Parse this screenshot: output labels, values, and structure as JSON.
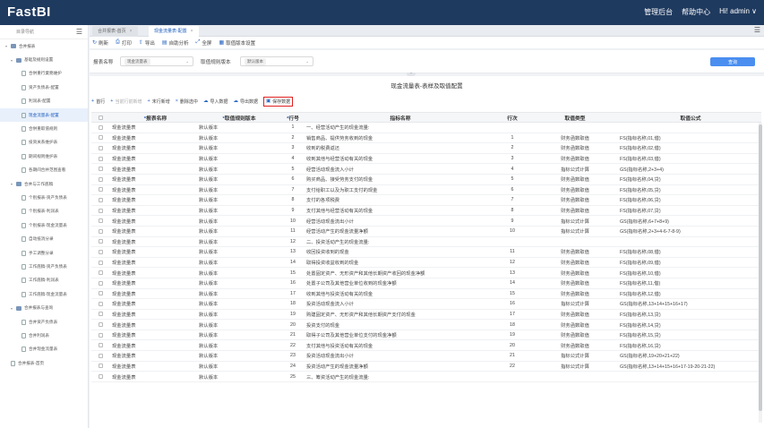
{
  "app": {
    "title": "FastBI",
    "nav": [
      "管理后台",
      "帮助中心",
      "Hi! admin ∨"
    ]
  },
  "sidebar": {
    "header": "目录导航",
    "items": [
      {
        "label": "合并报表",
        "level": 0,
        "kind": "folder",
        "expanded": true
      },
      {
        "label": "基础及规则设置",
        "level": 1,
        "kind": "folder",
        "expanded": true
      },
      {
        "label": "合併重行業務維护",
        "level": 2,
        "kind": "doc"
      },
      {
        "label": "资产负债表-配置",
        "level": 2,
        "kind": "doc"
      },
      {
        "label": "利润表-配置",
        "level": 2,
        "kind": "doc"
      },
      {
        "label": "现金流量表-配置",
        "level": 2,
        "kind": "doc",
        "active": true
      },
      {
        "label": "合併重取值规则",
        "level": 2,
        "kind": "doc"
      },
      {
        "label": "投资关系维护表",
        "level": 2,
        "kind": "doc"
      },
      {
        "label": "期间规则维护表",
        "level": 2,
        "kind": "doc"
      },
      {
        "label": "各期间合并范围查看",
        "level": 2,
        "kind": "doc"
      },
      {
        "label": "合并与工作底稿",
        "level": 1,
        "kind": "folder",
        "expanded": true
      },
      {
        "label": "个别报表-资产负债表",
        "level": 2,
        "kind": "doc"
      },
      {
        "label": "个别报表-利润表",
        "level": 2,
        "kind": "doc"
      },
      {
        "label": "个别报表-现金流量表",
        "level": 2,
        "kind": "doc"
      },
      {
        "label": "自动抵消分录",
        "level": 2,
        "kind": "doc"
      },
      {
        "label": "手工调整分录",
        "level": 2,
        "kind": "doc"
      },
      {
        "label": "工作底稿-资产负债表",
        "level": 2,
        "kind": "doc"
      },
      {
        "label": "工作底稿-利润表",
        "level": 2,
        "kind": "doc"
      },
      {
        "label": "工作底稿-现金流量表",
        "level": 2,
        "kind": "doc"
      },
      {
        "label": "合并报表与查询",
        "level": 1,
        "kind": "folder",
        "expanded": true
      },
      {
        "label": "合并资产负债表",
        "level": 2,
        "kind": "doc"
      },
      {
        "label": "合并利润表",
        "level": 2,
        "kind": "doc"
      },
      {
        "label": "合并现金流量表",
        "level": 2,
        "kind": "doc"
      },
      {
        "label": "合并报表-首页",
        "level": 1,
        "kind": "doc"
      }
    ]
  },
  "tabs": [
    {
      "label": "合并报表-首页",
      "active": false
    },
    {
      "label": "现金流量表-配置",
      "active": true
    }
  ],
  "toolbar": {
    "items": [
      {
        "icon": "↻",
        "label": "刷新"
      },
      {
        "icon": "⎙",
        "label": "打印"
      },
      {
        "icon": "⇧",
        "label": "导出"
      },
      {
        "icon": "▤",
        "label": "自助分析"
      },
      {
        "icon": "⤢",
        "label": "全屏"
      },
      {
        "icon": "▦",
        "label": "取值版本设置"
      }
    ]
  },
  "filters": {
    "report_label": "报表名称",
    "report_value": "现金流量表",
    "version_label": "取值规则版本",
    "version_value": "默认版本",
    "query_button": "查询"
  },
  "main": {
    "title": "现金流量表-表样及取值配置",
    "actions": [
      {
        "icon": "+",
        "label": "首行",
        "disabled": false
      },
      {
        "icon": "+",
        "label": "当前行前新增",
        "disabled": true
      },
      {
        "icon": "+",
        "label": "末行新增",
        "disabled": false
      },
      {
        "icon": "×",
        "label": "删除选中",
        "disabled": false
      },
      {
        "icon": "☁",
        "label": "导入数据",
        "disabled": false
      },
      {
        "icon": "☁",
        "label": "导出数据",
        "disabled": false
      },
      {
        "icon": "▣",
        "label": "保存数据",
        "disabled": false,
        "highlight": true
      }
    ]
  },
  "table": {
    "columns": {
      "name": "报表名称",
      "version": "取值规则版本",
      "seq": "行号",
      "indicator": "指标名称",
      "row": "行次",
      "type": "取值类型",
      "formula": "取值公式"
    },
    "rows": [
      {
        "name": "现金流量表",
        "version": "默认版本",
        "seq": "1",
        "indicator": "一、经营活动产生的现金流量:",
        "row": "",
        "type": "",
        "formula": ""
      },
      {
        "name": "现金流量表",
        "version": "默认版本",
        "seq": "2",
        "indicator": "销售商品、提供劳务收到的现金",
        "row": "1",
        "type": "财务函数取值",
        "formula": "FS(指标名称,01,借)"
      },
      {
        "name": "现金流量表",
        "version": "默认版本",
        "seq": "3",
        "indicator": "收到的税费返还",
        "row": "2",
        "type": "财务函数取值",
        "formula": "FS(指标名称,02,借)"
      },
      {
        "name": "现金流量表",
        "version": "默认版本",
        "seq": "4",
        "indicator": "收到其他与经营活动有关的现金",
        "row": "3",
        "type": "财务函数取值",
        "formula": "FS(指标名称,03,借)"
      },
      {
        "name": "现金流量表",
        "version": "默认版本",
        "seq": "5",
        "indicator": "经营活动现金流入小计",
        "row": "4",
        "type": "指标公式计算",
        "formula": "GS(指标名称,2+3+4)"
      },
      {
        "name": "现金流量表",
        "version": "默认版本",
        "seq": "6",
        "indicator": "购买商品、接受劳务支付的现金",
        "row": "5",
        "type": "财务函数取值",
        "formula": "FS(指标名称,04,贷)"
      },
      {
        "name": "现金流量表",
        "version": "默认版本",
        "seq": "7",
        "indicator": "支付给职工以及为职工支付的现金",
        "row": "6",
        "type": "财务函数取值",
        "formula": "FS(指标名称,05,贷)"
      },
      {
        "name": "现金流量表",
        "version": "默认版本",
        "seq": "8",
        "indicator": "支付的各项税费",
        "row": "7",
        "type": "财务函数取值",
        "formula": "FS(指标名称,06,贷)"
      },
      {
        "name": "现金流量表",
        "version": "默认版本",
        "seq": "9",
        "indicator": "支付其他与经营活动有关的现金",
        "row": "8",
        "type": "财务函数取值",
        "formula": "FS(指标名称,07,贷)"
      },
      {
        "name": "现金流量表",
        "version": "默认版本",
        "seq": "10",
        "indicator": "经营活动现金流出小计",
        "row": "9",
        "type": "指标公式计算",
        "formula": "GS(指标名称,6+7+8+9)"
      },
      {
        "name": "现金流量表",
        "version": "默认版本",
        "seq": "11",
        "indicator": "经营活动产生的现金流量净额",
        "row": "10",
        "type": "指标公式计算",
        "formula": "GS(指标名称,2+3+4-6-7-8-9)"
      },
      {
        "name": "现金流量表",
        "version": "默认版本",
        "seq": "12",
        "indicator": "二、投资活动产生的现金流量:",
        "row": "",
        "type": "",
        "formula": ""
      },
      {
        "name": "现金流量表",
        "version": "默认版本",
        "seq": "13",
        "indicator": "收回投资收到的现金",
        "row": "11",
        "type": "财务函数取值",
        "formula": "FS(指标名称,08,借)"
      },
      {
        "name": "现金流量表",
        "version": "默认版本",
        "seq": "14",
        "indicator": "取得投资收益收到的现金",
        "row": "12",
        "type": "财务函数取值",
        "formula": "FS(指标名称,09,借)"
      },
      {
        "name": "现金流量表",
        "version": "默认版本",
        "seq": "15",
        "indicator": "处置固定资产、无形资产和其他长期资产收回的现金净额",
        "row": "13",
        "type": "财务函数取值",
        "formula": "FS(指标名称,10,借)"
      },
      {
        "name": "现金流量表",
        "version": "默认版本",
        "seq": "16",
        "indicator": "处置子公司及其他营业单位收到的现金净额",
        "row": "14",
        "type": "财务函数取值",
        "formula": "FS(指标名称,11,借)"
      },
      {
        "name": "现金流量表",
        "version": "默认版本",
        "seq": "17",
        "indicator": "收到其他与投资活动有关的现金",
        "row": "15",
        "type": "财务函数取值",
        "formula": "FS(指标名称,12,借)"
      },
      {
        "name": "现金流量表",
        "version": "默认版本",
        "seq": "18",
        "indicator": "投资活动现金流入小计",
        "row": "16",
        "type": "指标公式计算",
        "formula": "GS(指标名称,13+14+15+16+17)"
      },
      {
        "name": "现金流量表",
        "version": "默认版本",
        "seq": "19",
        "indicator": "购建固定资产、无形资产和其他长期资产支付的现金",
        "row": "17",
        "type": "财务函数取值",
        "formula": "FS(指标名称,13,贷)"
      },
      {
        "name": "现金流量表",
        "version": "默认版本",
        "seq": "20",
        "indicator": "投资支付的现金",
        "row": "18",
        "type": "财务函数取值",
        "formula": "FS(指标名称,14,贷)"
      },
      {
        "name": "现金流量表",
        "version": "默认版本",
        "seq": "21",
        "indicator": "取得子公司及其他营业单位支付的现金净额",
        "row": "19",
        "type": "财务函数取值",
        "formula": "FS(指标名称,15,贷)"
      },
      {
        "name": "现金流量表",
        "version": "默认版本",
        "seq": "22",
        "indicator": "支付其他与投资活动有关的现金",
        "row": "20",
        "type": "财务函数取值",
        "formula": "FS(指标名称,16,贷)"
      },
      {
        "name": "现金流量表",
        "version": "默认版本",
        "seq": "23",
        "indicator": "投资活动现金流出小计",
        "row": "21",
        "type": "指标公式计算",
        "formula": "GS(指标名称,19+20+21+22)"
      },
      {
        "name": "现金流量表",
        "version": "默认版本",
        "seq": "24",
        "indicator": "投资活动产生的现金流量净额",
        "row": "22",
        "type": "指标公式计算",
        "formula": "GS(指标名称,13+14+15+16+17-19-20-21-22)"
      },
      {
        "name": "现金流量表",
        "version": "默认版本",
        "seq": "25",
        "indicator": "三、筹资活动产生的现金流量:",
        "row": "",
        "type": "",
        "formula": ""
      }
    ]
  }
}
